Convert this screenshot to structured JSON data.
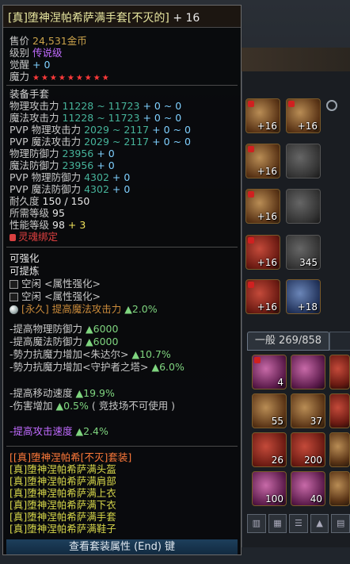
{
  "item": {
    "title_name": "[真]堕神涅帕希萨满手套[不灭的]",
    "title_plus": "+ 16",
    "price_label": "售价",
    "price_value": "24,531金币",
    "level_label": "级别",
    "level_value": "传说级",
    "awaken_label": "觉醒",
    "awaken_value": "+ 0",
    "magic_label": "魔力",
    "magic_stars": "★★★★★★★★★",
    "equip_type": "装备手套",
    "stats": [
      {
        "label": "物理攻击力",
        "value": "11228 ~ 11723",
        "extra": "+ 0 ~ 0"
      },
      {
        "label": "魔法攻击力",
        "value": "11228 ~ 11723",
        "extra": "+ 0 ~ 0"
      },
      {
        "label": "PVP 物理攻击力",
        "value": "2029 ~ 2117",
        "extra": "+ 0 ~ 0"
      },
      {
        "label": "PVP 魔法攻击力",
        "value": "2029 ~ 2117",
        "extra": "+ 0 ~ 0"
      },
      {
        "label": "物理防御力",
        "value": "23956",
        "extra": "+ 0"
      },
      {
        "label": "魔法防御力",
        "value": "23956",
        "extra": "+ 0"
      },
      {
        "label": "PVP 物理防御力",
        "value": "4302",
        "extra": "+ 0"
      },
      {
        "label": "PVP 魔法防御力",
        "value": "4302",
        "extra": "+ 0"
      }
    ],
    "durability_label": "耐久度",
    "durability_value": "150 / 150",
    "req_level_label": "所需等级",
    "req_level_value": "95",
    "perf_level_label": "性能等级",
    "perf_level_value": "98",
    "perf_level_bonus": "+ 3",
    "soul_bind": "灵魂绑定",
    "enhance_title": "可强化",
    "refine_title": "可提炼",
    "socket1": "空闲 <属性强化>",
    "socket2": "空闲 <属性强化>",
    "perm_tag": "[永久]",
    "perm_text": "提高魔法攻击力",
    "perm_value": "▲2.0%",
    "effects1": [
      {
        "label": "-提高物理防御力",
        "value": "▲6000"
      },
      {
        "label": "-提高魔法防御力",
        "value": "▲6000"
      },
      {
        "label": "-勢力抗魔力增加<朱达尔>",
        "value": "▲10.7%"
      },
      {
        "label": "-勢力抗魔力增加<守护者之塔>",
        "value": "▲6.0%"
      }
    ],
    "move_speed_label": "-提高移动速度",
    "move_speed_value": "▲19.9%",
    "damage_label": "-伤害增加",
    "damage_value": "▲0.5%",
    "damage_note": "( 竞技场不可使用 )",
    "attack_speed_label": "-提高攻击速度",
    "attack_speed_value": "▲2.4%",
    "set_name": "[[真]堕神涅帕希[不灭]套装]",
    "set_items": [
      "[真]堕神涅帕希萨满头盔",
      "[真]堕神涅帕希萨满肩部",
      "[真]堕神涅帕希萨满上衣",
      "[真]堕神涅帕希萨满下衣",
      "[真]堕神涅帕希萨满手套",
      "[真]堕神涅帕希萨满鞋子"
    ],
    "footer": "查看套装属性 (End) 键"
  },
  "inventory": {
    "tab_label": "一般 269/858",
    "equip_counts": [
      "+16",
      "+16",
      "+16",
      "+16",
      "+16",
      "345",
      "+16",
      "+18"
    ],
    "grid_counts": [
      "4",
      "",
      "",
      "55",
      "37",
      "",
      "26",
      "200",
      "",
      "100",
      "40",
      ""
    ]
  },
  "colors": {
    "title": "#e8e7a0",
    "price": "#c9a24b",
    "legendary": "#c06bff",
    "stat_value": "#46b39a",
    "enhance_up": "#7fd57f",
    "set_name": "#ff7a3a",
    "set_item": "#d8d84a",
    "footer_bg": "#1d3f5c"
  }
}
